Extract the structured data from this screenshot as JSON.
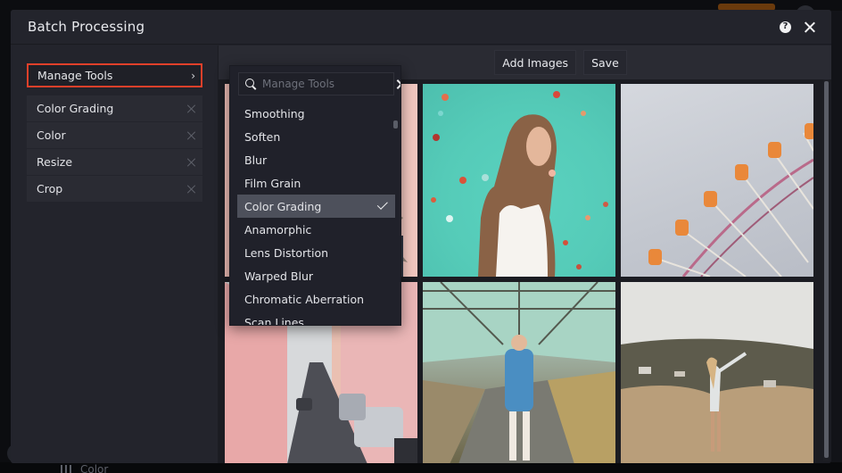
{
  "dialog": {
    "title": "Batch Processing",
    "help_icon": "help-circle-icon",
    "close_icon": "close-icon"
  },
  "sidebar": {
    "manage_tools_label": "Manage Tools",
    "manage_tools_icon": "chevron-right-icon",
    "highlight_color": "#e0402a",
    "tools": [
      {
        "label": "Color Grading"
      },
      {
        "label": "Color"
      },
      {
        "label": "Resize"
      },
      {
        "label": "Crop"
      }
    ]
  },
  "toolbar": {
    "add_images_label": "Add Images",
    "save_label": "Save"
  },
  "dropdown": {
    "search_placeholder": "Manage Tools",
    "search_value": "",
    "items": [
      {
        "label": "Smoothing",
        "selected": false
      },
      {
        "label": "Soften",
        "selected": false
      },
      {
        "label": "Blur",
        "selected": false
      },
      {
        "label": "Film Grain",
        "selected": false
      },
      {
        "label": "Color Grading",
        "selected": true
      },
      {
        "label": "Anamorphic",
        "selected": false
      },
      {
        "label": "Lens Distortion",
        "selected": false
      },
      {
        "label": "Warped Blur",
        "selected": false
      },
      {
        "label": "Chromatic Aberration",
        "selected": false
      },
      {
        "label": "Scan Lines",
        "selected": false
      }
    ]
  },
  "images": [
    {
      "subject": "pink building facade with palm shadow"
    },
    {
      "subject": "woman with confetti on teal background"
    },
    {
      "subject": "ferris wheel with orange gondolas against grey sky"
    },
    {
      "subject": "narrow street with parked cars and pastel buildings"
    },
    {
      "subject": "woman in denim dress in greenhouse"
    },
    {
      "subject": "woman on hill overlooking town"
    }
  ],
  "background": {
    "bottom_label": "Color"
  }
}
